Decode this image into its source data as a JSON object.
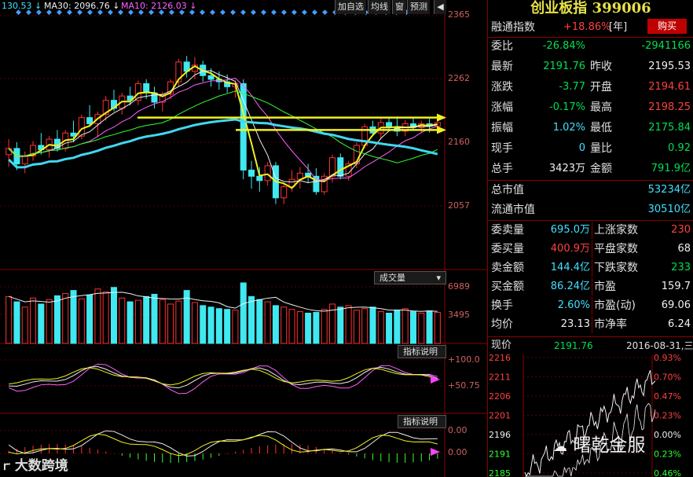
{
  "toolbar": {
    "ma_first": "130.53 ↓",
    "ma30": "MA30: 2096.76 ↓",
    "ma10": "MA10: 2126.03 ↓",
    "buttons": [
      "加自选",
      "均线",
      "窗",
      "预测"
    ],
    "arrow_icon": "back-arrow-icon"
  },
  "chart_data": [
    {
      "type": "candlestick",
      "yticks": [
        "2365",
        "2262",
        "2160",
        "2057"
      ],
      "ylim": [
        2030,
        2365
      ],
      "candles": [
        [
          2140,
          2165,
          2120,
          2150
        ],
        [
          2150,
          2160,
          2115,
          2125
        ],
        [
          2125,
          2145,
          2110,
          2138
        ],
        [
          2138,
          2162,
          2130,
          2155
        ],
        [
          2155,
          2175,
          2140,
          2148
        ],
        [
          2148,
          2170,
          2135,
          2165
        ],
        [
          2165,
          2180,
          2145,
          2150
        ],
        [
          2150,
          2180,
          2145,
          2175
        ],
        [
          2175,
          2195,
          2160,
          2170
        ],
        [
          2170,
          2205,
          2165,
          2200
        ],
        [
          2200,
          2220,
          2185,
          2190
        ],
        [
          2190,
          2210,
          2170,
          2205
        ],
        [
          2205,
          2235,
          2195,
          2228
        ],
        [
          2228,
          2245,
          2210,
          2215
        ],
        [
          2215,
          2240,
          2205,
          2235
        ],
        [
          2235,
          2250,
          2220,
          2228
        ],
        [
          2228,
          2260,
          2220,
          2255
        ],
        [
          2255,
          2262,
          2230,
          2240
        ],
        [
          2240,
          2250,
          2215,
          2225
        ],
        [
          2225,
          2242,
          2210,
          2238
        ],
        [
          2238,
          2262,
          2230,
          2258
        ],
        [
          2258,
          2295,
          2250,
          2290
        ],
        [
          2290,
          2300,
          2265,
          2275
        ],
        [
          2275,
          2298,
          2262,
          2285
        ],
        [
          2285,
          2292,
          2258,
          2268
        ],
        [
          2268,
          2280,
          2250,
          2262
        ],
        [
          2262,
          2275,
          2245,
          2258
        ],
        [
          2258,
          2270,
          2240,
          2250
        ],
        [
          2250,
          2260,
          2232,
          2255
        ],
        [
          2255,
          2262,
          2100,
          2115
        ],
        [
          2115,
          2130,
          2085,
          2105
        ],
        [
          2105,
          2120,
          2080,
          2098
        ],
        [
          2098,
          2128,
          2090,
          2122
        ],
        [
          2122,
          2128,
          2060,
          2070
        ],
        [
          2070,
          2092,
          2060,
          2088
        ],
        [
          2088,
          2115,
          2080,
          2100
        ],
        [
          2100,
          2120,
          2085,
          2110
        ],
        [
          2110,
          2125,
          2095,
          2105
        ],
        [
          2105,
          2118,
          2075,
          2080
        ],
        [
          2080,
          2110,
          2075,
          2105
        ],
        [
          2105,
          2140,
          2095,
          2135
        ],
        [
          2135,
          2142,
          2100,
          2105
        ],
        [
          2105,
          2130,
          2098,
          2125
        ],
        [
          2125,
          2160,
          2118,
          2155
        ],
        [
          2155,
          2190,
          2150,
          2185
        ],
        [
          2185,
          2195,
          2170,
          2175
        ],
        [
          2175,
          2198,
          2165,
          2192
        ],
        [
          2192,
          2200,
          2178,
          2185
        ],
        [
          2185,
          2202,
          2170,
          2178
        ],
        [
          2178,
          2196,
          2170,
          2190
        ],
        [
          2190,
          2200,
          2180,
          2184
        ],
        [
          2184,
          2195,
          2175,
          2190
        ],
        [
          2190,
          2198,
          2176,
          2186
        ],
        [
          2186,
          2198,
          2176,
          2192
        ]
      ],
      "hlines": [
        2200,
        2180
      ]
    },
    {
      "type": "bar",
      "label": "成交量",
      "yticks": [
        "6989",
        "3495"
      ],
      "values": [
        62,
        55,
        48,
        60,
        52,
        58,
        63,
        66,
        70,
        59,
        64,
        72,
        68,
        74,
        60,
        55,
        57,
        62,
        65,
        58,
        52,
        56,
        70,
        54,
        50,
        48,
        46,
        45,
        44,
        80,
        62,
        58,
        55,
        50,
        48,
        45,
        42,
        40,
        41,
        45,
        52,
        48,
        50,
        44,
        46,
        48,
        42,
        40,
        44,
        46,
        42,
        40,
        43,
        41
      ]
    },
    {
      "type": "line",
      "label": "指标说明",
      "yticks": [
        "+100.0",
        "+50.75"
      ]
    },
    {
      "type": "line",
      "label": "指标说明",
      "yticks": [
        "0.00",
        "0.00"
      ]
    },
    {
      "type": "line",
      "label": "intraday",
      "yticks_left": [
        "2216",
        "2211",
        "2206",
        "2201",
        "2196",
        "2191",
        "2185"
      ],
      "yticks_right": [
        "0.93%",
        "0.70%",
        "0.47%",
        "0.23%",
        "0.00%",
        "0.23%",
        "0.46%"
      ]
    }
  ],
  "side": {
    "title": "创业板指 399006",
    "rz_label": "融通指数",
    "rz_value": "+18.86%",
    "rz_unit": "[年]",
    "buy": "购买",
    "rows": [
      {
        "l1": "委比",
        "v1": "-26.84%",
        "l2": "",
        "v2": "-2941166"
      },
      {
        "l1": "最新",
        "v1": "2191.76",
        "l2": "昨收",
        "v2": "2195.53"
      },
      {
        "l1": "涨跌",
        "v1": "-3.77",
        "l2": "开盘",
        "v2": "2194.61"
      },
      {
        "l1": "涨幅",
        "v1": "-0.17%",
        "l2": "最高",
        "v2": "2198.25"
      },
      {
        "l1": "振幅",
        "v1": "1.02%",
        "l2": "最低",
        "v2": "2175.84"
      },
      {
        "l1": "现手",
        "v1": "0",
        "l2": "量比",
        "v2": "0.92"
      },
      {
        "l1": "总手",
        "v1": "3423万",
        "l2": "金额",
        "v2": "791.9亿"
      }
    ],
    "mkt": [
      {
        "l": "总市值",
        "v": "53234亿"
      },
      {
        "l": "流通市值",
        "v": "30510亿"
      }
    ],
    "stats": [
      {
        "l1": "委卖量",
        "v1": "695.0万",
        "l2": "上涨家数",
        "v2": "230"
      },
      {
        "l1": "委买量",
        "v1": "400.9万",
        "l2": "平盘家数",
        "v2": "68"
      },
      {
        "l1": "卖金额",
        "v1": "144.4亿",
        "l2": "下跌家数",
        "v2": "233"
      },
      {
        "l1": "买金额",
        "v1": "86.24亿",
        "l2": "市盈",
        "v2": "159.7"
      },
      {
        "l1": "换手",
        "v1": "2.60%",
        "l2": "市盈(动)",
        "v2": "69.06"
      },
      {
        "l1": "均价",
        "v1": "23.13",
        "l2": "市净率",
        "v2": "6.24"
      }
    ],
    "price_label": "现价",
    "price_value": "2191.76",
    "date": "2016-08-31,三"
  },
  "watermarks": {
    "left": "大数跨境",
    "right": "曙乾金服"
  }
}
